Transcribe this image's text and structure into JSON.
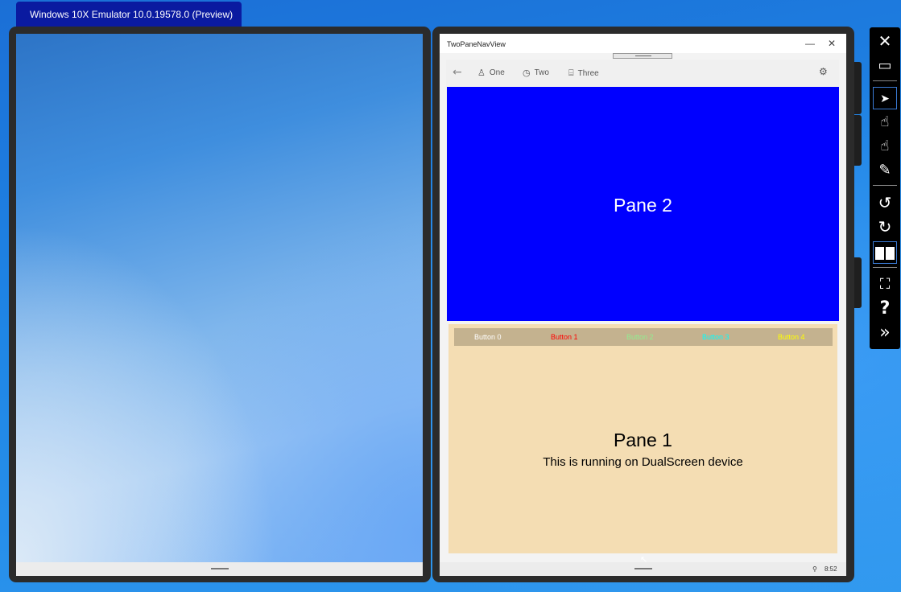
{
  "emulator": {
    "title": "Windows 10X Emulator 10.0.19578.0 (Preview)"
  },
  "app": {
    "window_title": "TwoPaneNavView",
    "minimize_glyph": "—",
    "close_glyph": "✕",
    "nav": {
      "back_icon": "back-arrow-icon",
      "back_glyph": "←",
      "items": [
        {
          "label": "One",
          "icon": "person-icon",
          "glyph": "♙"
        },
        {
          "label": "Two",
          "icon": "clock-icon",
          "glyph": "◷"
        },
        {
          "label": "Three",
          "icon": "camera-icon",
          "glyph": "⌸"
        }
      ],
      "settings_icon": "gear-icon",
      "settings_glyph": "⚙"
    },
    "pane2": {
      "label": "Pane 2",
      "color": "#0000ff"
    },
    "pane1": {
      "buttons": [
        {
          "label": "Button 0",
          "color": "#ffffff"
        },
        {
          "label": "Button 1",
          "color": "#ff0000"
        },
        {
          "label": "Button 2",
          "color": "#90ee90"
        },
        {
          "label": "Button 3",
          "color": "#00ffff"
        },
        {
          "label": "Button 4",
          "color": "#ffff00"
        }
      ],
      "title": "Pane 1",
      "subtitle": "This is running on DualScreen device",
      "color": "#f4ddb3"
    },
    "taskbar": {
      "time": "8:52"
    }
  },
  "toolbar": {
    "items": [
      {
        "name": "close-icon",
        "glyph": "✕"
      },
      {
        "name": "minimize-icon",
        "glyph": "▭"
      },
      {
        "name": "pointer-icon",
        "glyph": "➤"
      },
      {
        "name": "single-touch-icon",
        "glyph": "☝"
      },
      {
        "name": "multi-touch-icon",
        "glyph": "☝"
      },
      {
        "name": "pen-icon",
        "glyph": "✎"
      },
      {
        "name": "rotate-left-icon",
        "glyph": "↺"
      },
      {
        "name": "rotate-right-icon",
        "glyph": "↻"
      },
      {
        "name": "dual-screen-icon",
        "glyph": "▯"
      },
      {
        "name": "fit-screen-icon",
        "glyph": "⛶"
      },
      {
        "name": "help-icon",
        "glyph": "?"
      },
      {
        "name": "more-icon",
        "glyph": "»"
      }
    ]
  }
}
